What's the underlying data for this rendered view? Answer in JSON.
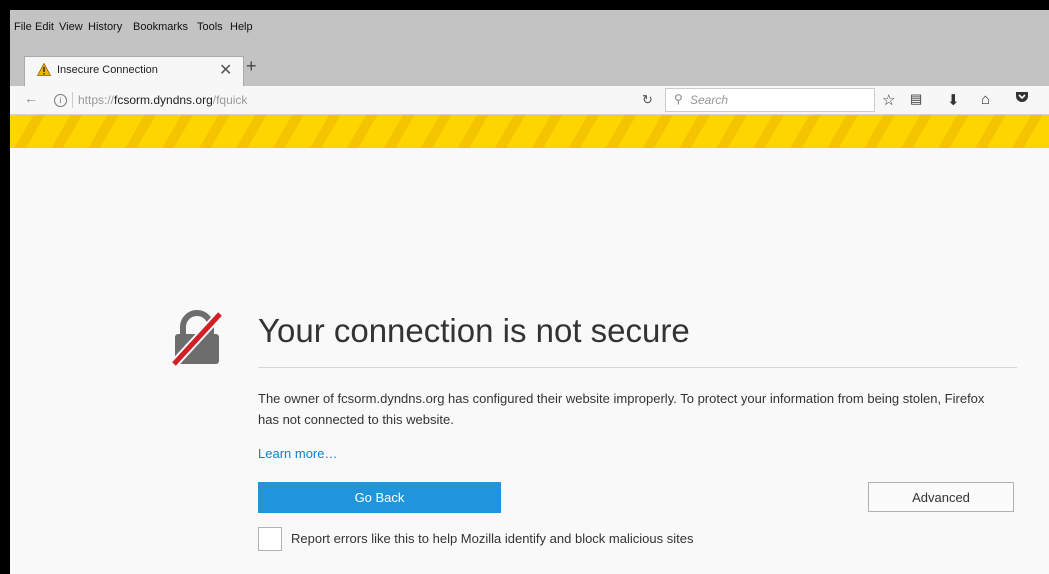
{
  "menu": [
    "File",
    "Edit",
    "View",
    "History",
    "Bookmarks",
    "Tools",
    "Help"
  ],
  "tab": {
    "title": "Insecure Connection",
    "close": "✕",
    "new": "+"
  },
  "nav": {
    "url_prefix": "https://",
    "url_host": "fcsorm.dyndns.org",
    "url_path": "/fquick",
    "search_placeholder": "Search",
    "icons": [
      "back-arrow-icon",
      "info-icon",
      "reload-icon",
      "search-icon",
      "star-icon",
      "reader-list-icon",
      "download-icon",
      "home-icon",
      "pocket-icon"
    ]
  },
  "error_page": {
    "title": "Your connection is not secure",
    "description": "The owner of fcsorm.dyndns.org has configured their website improperly. To protect your information from being stolen, Firefox has not connected to this website.",
    "learn_more": "Learn more…",
    "go_back": "Go Back",
    "advanced": "Advanced",
    "report_label": "Report errors like this to help Mozilla identify and block malicious sites",
    "report_checked": false
  },
  "colors": {
    "accent": "#1f95dc",
    "stripe_yellow": "#ffd500",
    "lock_gray": "#6d6d6d",
    "lock_slash": "#d11f26"
  }
}
